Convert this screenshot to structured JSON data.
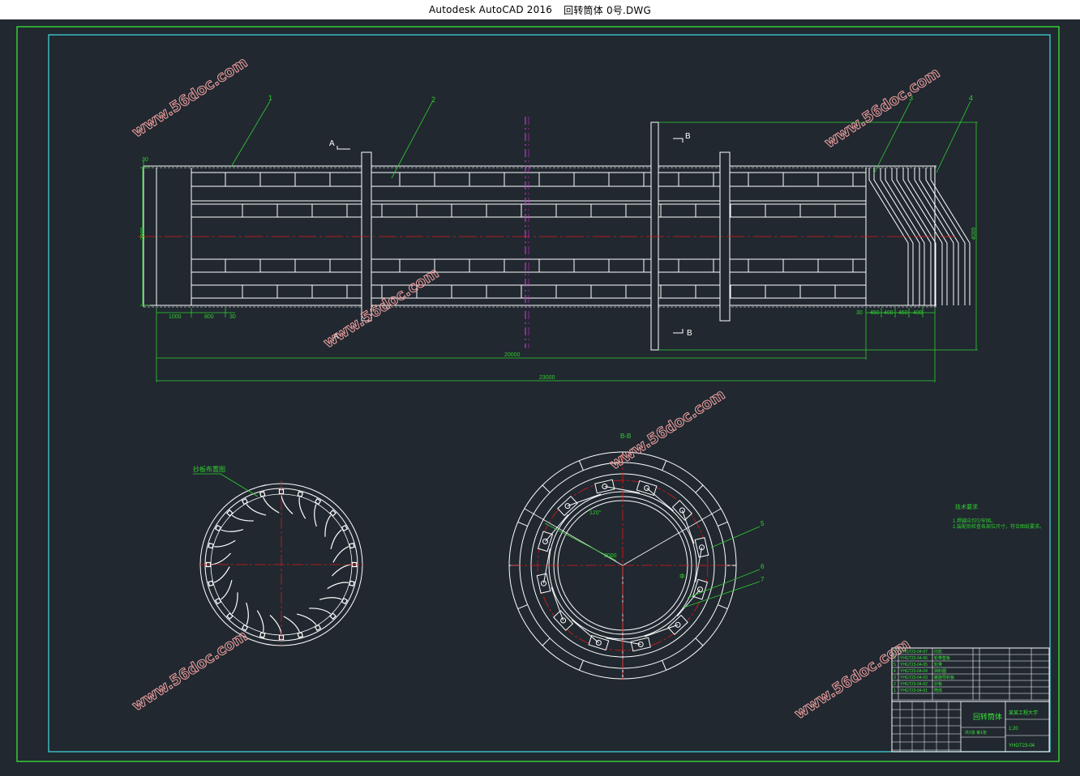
{
  "window": {
    "app_title": "Autodesk AutoCAD 2016",
    "file_name": "回转筒体 0号.DWG"
  },
  "colors": {
    "background": "#212830",
    "outer_frame": "#37e637",
    "inner_frame": "#3fd0d8",
    "geometry": "#ffffff",
    "centerline": "#e01818",
    "dimension": "#2ed02e",
    "hatch": "#d030d0",
    "watermark": "#f0a0a0"
  },
  "drawing": {
    "part_labels": [
      "1",
      "2",
      "3",
      "4",
      "5",
      "6",
      "7"
    ],
    "section_markers": {
      "a": "A",
      "b": "B"
    },
    "dims": {
      "left_end": "30",
      "seg1": "1000",
      "seg2": "800",
      "seg3": "30",
      "overall_inner": "20000",
      "overall": "23000",
      "right_d1": "30",
      "right_d2": "450",
      "right_d3": "400",
      "right_d4": "450",
      "right_d5": "400",
      "left_height": "2800",
      "right_height": "4000",
      "radius_label": "2000",
      "angle_label": "120°"
    },
    "notes": {
      "left_section_label": "抄板布置图",
      "section_title": "B-B",
      "tech_title": "技术要求",
      "tech_items": [
        "1.焊缝应均匀牢固。",
        "2.装配后检查各部位尺寸，符合图纸要求。"
      ]
    },
    "watermark_text": "www.56doc.com"
  },
  "title_block": {
    "bom": [
      {
        "no": "7",
        "code": "YHGT23-04-07",
        "name": "托轮"
      },
      {
        "no": "6",
        "code": "YHGT23-04-06",
        "name": "轮带垫板"
      },
      {
        "no": "5",
        "code": "YHGT23-04-05",
        "name": "轮带"
      },
      {
        "no": "4",
        "code": "YHGT23-04-04",
        "name": "挡料圈"
      },
      {
        "no": "3",
        "code": "YHGT23-04-03",
        "name": "螺旋导料板"
      },
      {
        "no": "2",
        "code": "YHGT23-04-02",
        "name": "抄板"
      },
      {
        "no": "1",
        "code": "YHGT23-04-01",
        "name": "筒体"
      }
    ],
    "part_title": "回转筒体",
    "school": "某某工程大学",
    "drawing_no": "YHGT23-04",
    "scale": "1:20",
    "sheet": "共1张 第1张"
  }
}
